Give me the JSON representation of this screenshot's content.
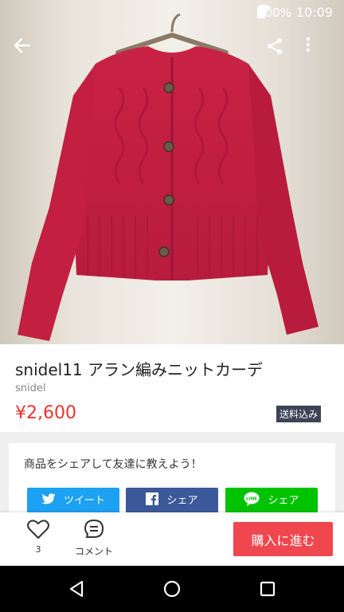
{
  "status_bar": {
    "battery": "100%",
    "time": "10:09"
  },
  "product": {
    "title": "snidel11 アラン編みニットカーデ",
    "brand": "snidel",
    "price": "¥2,600",
    "shipping_badge": "送料込み"
  },
  "share": {
    "prompt": "商品をシェアして友達に教えよう！",
    "buttons": [
      {
        "label": "ツイート",
        "icon": "twitter-icon",
        "color": "#1da1f2"
      },
      {
        "label": "シェア",
        "icon": "facebook-icon",
        "color": "#3b5998"
      },
      {
        "label": "シェア",
        "icon": "line-icon",
        "color": "#00c300"
      }
    ]
  },
  "actions": {
    "like_count": "3",
    "comment_label": "コメント",
    "buy_label": "購入に進む",
    "buy_color": "#f0474e"
  },
  "colors": {
    "price": "#ea352d",
    "badge_bg": "#3c4456"
  }
}
